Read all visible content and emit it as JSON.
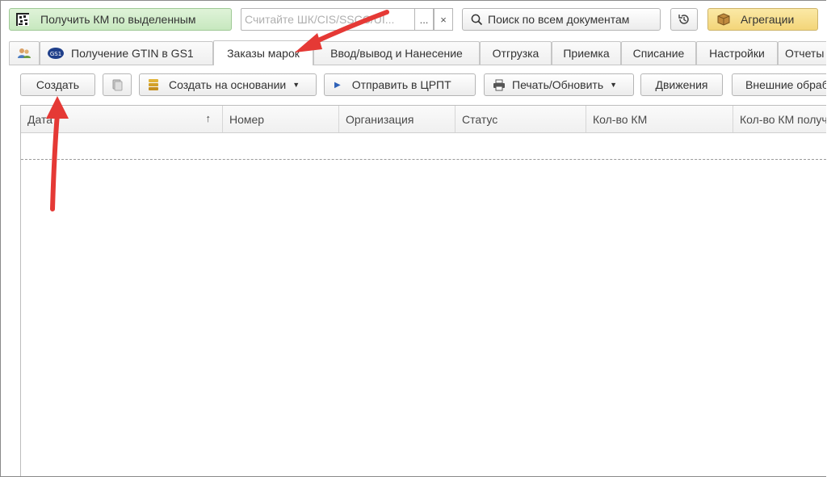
{
  "topbar": {
    "get_km_button": "Получить КМ по выделенным",
    "scan_placeholder": "Считайте ШК/CIS/SSCC/UI...",
    "select_button": "...",
    "clear_button": "×",
    "search_button": "Поиск по всем документам",
    "aggregation_button": "Агрегации"
  },
  "tabs": [
    {
      "label": ""
    },
    {
      "label": "Получение GTIN в GS1"
    },
    {
      "label": "Заказы марок"
    },
    {
      "label": "Ввод/вывод и Нанесение"
    },
    {
      "label": "Отгрузка"
    },
    {
      "label": "Приемка"
    },
    {
      "label": "Списание"
    },
    {
      "label": "Настройки"
    },
    {
      "label": "Отчеты"
    }
  ],
  "toolbar": {
    "create": "Создать",
    "create_based_on": "Создать на основании",
    "send_crpt": "Отправить в ЦРПТ",
    "print_refresh": "Печать/Обновить",
    "movements": "Движения",
    "external": "Внешние обработки"
  },
  "table": {
    "columns": [
      "Дата",
      "Номер",
      "Организация",
      "Статус",
      "Кол-во КМ",
      "Кол-во КМ получено"
    ],
    "sort_indicator": "↑"
  },
  "colors": {
    "annotation_arrow": "#e53935",
    "green_button": "#c7e8bf",
    "yellow_button": "#f3d579"
  }
}
